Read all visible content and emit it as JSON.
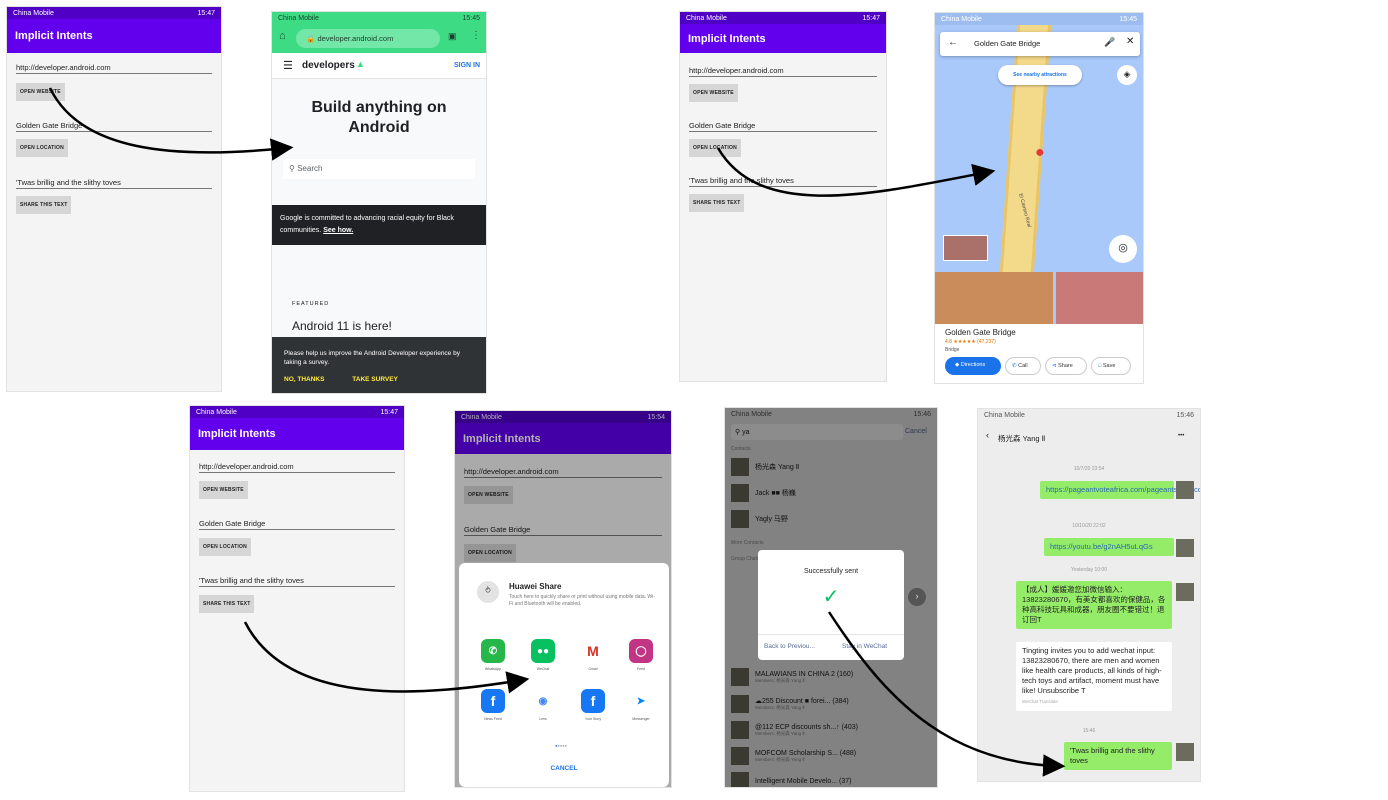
{
  "status": {
    "carrier": "China Mobile",
    "icons": "⁴ᴳ.ıl ≈ ↑ T ✶ ▣ ✈ ···",
    "battery": "⊶ ▭",
    "times": [
      "15:47",
      "15:45",
      "15:47",
      "15:45",
      "15:47",
      "15:54",
      "15:46",
      "15:46"
    ]
  },
  "app": {
    "title": "Implicit Intents",
    "url_value": "http://developer.android.com",
    "open_website": "OPEN WEBSITE",
    "location_value": "Golden Gate Bridge",
    "open_location": "OPEN LOCATION",
    "text_value": "'Twas brillig and the slithy toves",
    "share_text": "SHARE THIS TEXT"
  },
  "browser": {
    "url": "developer.android.com",
    "brand": "developers",
    "sign_in": "SIGN IN",
    "hero": "Build anything on Android",
    "search": "Search",
    "banner": "Google is committed to advancing racial equity for Black communities.",
    "banner_link": "See how.",
    "featured": "FEATURED",
    "featured_title": "Android 11 is here!",
    "survey": "Please help us improve the Android Developer experience by taking a survey.",
    "no_thanks": "NO, THANKS",
    "take_survey": "TAKE SURVEY"
  },
  "maps": {
    "query": "Golden Gate Bridge",
    "nearby": "See nearby attractions",
    "road_label": "El Camino Real",
    "place_name": "Golden Gate Bridge",
    "rating": "4.8 ★★★★★ (47,237)",
    "category": "Bridge",
    "directions": "Directions",
    "call": "Call",
    "share": "Share",
    "save": "Save"
  },
  "share_sheet": {
    "huawei_title": "Huawei Share",
    "huawei_desc": "Touch here to quickly share or print without using mobile data. Wi-Fi and Bluetooth will be enabled.",
    "apps": [
      "WhatsApp",
      "WeChat",
      "Gmail",
      "Feed",
      "News Feed",
      "Lens",
      "Your Story",
      "Messenger"
    ],
    "cancel": "CANCEL"
  },
  "wechat_search": {
    "query": "ya",
    "cancel": "Cancel",
    "section_contacts": "Contacts",
    "contacts": [
      "杨光森 Yang Ⅱ",
      "Jack ■■ 杨巍",
      "Yagly 马野"
    ],
    "section_more": "More Contacts",
    "section_groups": "Group Chats",
    "groups": [
      {
        "name": "MALAWIANS IN CHINA 2 (160)",
        "members": "Members: 杨光森 Yang Ⅱ"
      },
      {
        "name": "☁255 Discount ■ forei... (384)",
        "members": "Members: 杨光森 Yang Ⅱ"
      },
      {
        "name": "@112 ECP discounts sh...↑ (403)",
        "members": "Members: 杨光森 Yang Ⅱ"
      },
      {
        "name": "MOFCOM Scholarship S... (488)",
        "members": "Members: 杨光森 Yang Ⅱ"
      },
      {
        "name": "Intelligent Mobile Develo... (37)",
        "members": ""
      }
    ],
    "dialog_title": "Successfully sent",
    "back": "Back to Previou...",
    "stay": "Stay in WeChat"
  },
  "wechat_chat": {
    "contact": "杨光森 Yang Ⅱ",
    "more": "•••",
    "t1": "10/7/20 23:54",
    "m1": "https://pageantvoteafrica.com/pageants/224/contestants/1650",
    "t2": "10/10/20 22:02",
    "m2": "https://youtu.be/g2nAH5uLqGs",
    "t3": "Yesterday 10:00",
    "m3": "【成人】媛媛邀您加微信输入：13823280670，有美女都喜欢的保健品，各种高科技玩具和成器，朋友圈不要错过！退订回T",
    "m4": "Tingting invites you to add wechat input: 13823280670, there are men and women like health care products, all kinds of high-tech toys and artifact, moment must have like! Unsubscribe T",
    "translate": "WeChat Translate",
    "t4": "15:46",
    "m5": "'Twas brillig and the slithy toves"
  },
  "colors": {
    "purple": "#6200ee",
    "wechat_green": "#95ec69",
    "maps_blue": "#1a73e8"
  }
}
